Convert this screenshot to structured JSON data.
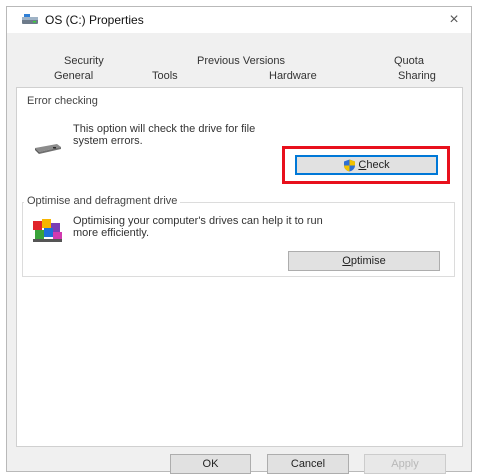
{
  "window": {
    "title": "OS (C:) Properties",
    "close_glyph": "×",
    "icon": "drive-icon"
  },
  "tabs": {
    "row1": [
      "Security",
      "Previous Versions",
      "Quota"
    ],
    "row2": [
      "General",
      "Tools",
      "Hardware",
      "Sharing"
    ],
    "active": "Tools"
  },
  "error_checking": {
    "title": "Error checking",
    "description_line1": "This option will check the drive for file",
    "description_line2": "system errors.",
    "icon": "hard-drive-icon",
    "button": {
      "label_prefix": "",
      "mnemonic": "C",
      "label_rest": "heck",
      "icon": "shield-icon"
    }
  },
  "optimise": {
    "title": "Optimise and defragment drive",
    "description_line1": "Optimising your computer's drives can help it to run",
    "description_line2": "more efficiently.",
    "icon": "defrag-icon",
    "button": {
      "mnemonic": "O",
      "label_rest": "ptimise"
    }
  },
  "footer": {
    "ok": "OK",
    "cancel": "Cancel",
    "apply": "Apply"
  },
  "colors": {
    "highlight": "#e8101c",
    "accent": "#0078d7"
  }
}
